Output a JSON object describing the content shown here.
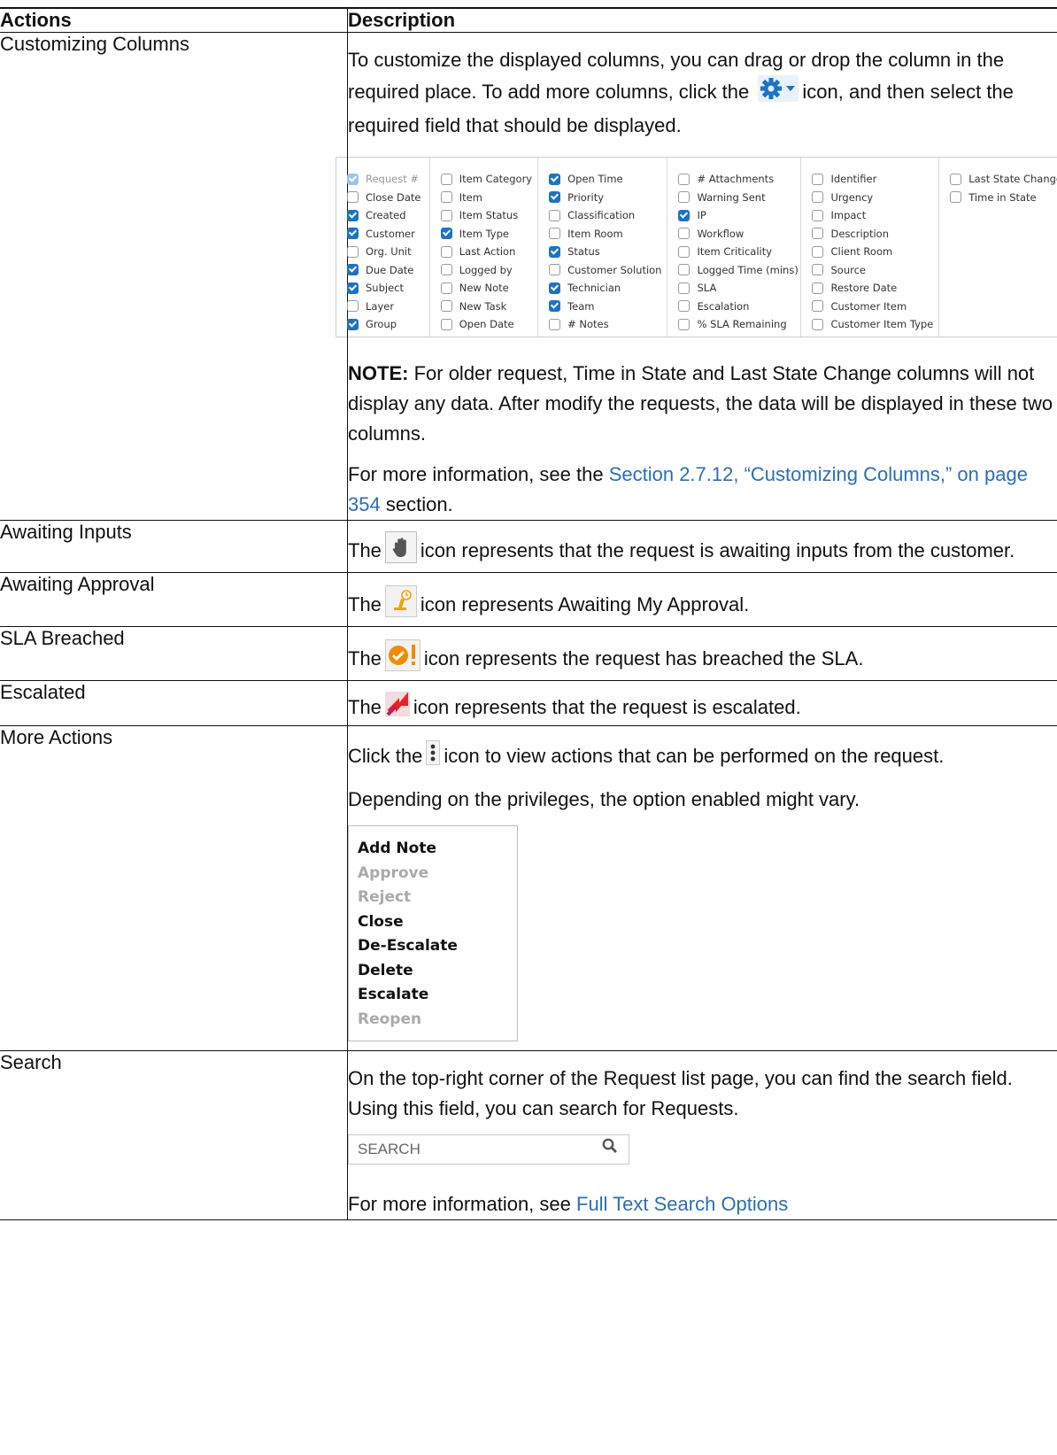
{
  "header": {
    "actions": "Actions",
    "description": "Description"
  },
  "rows": {
    "customizing": {
      "action": "Customizing Columns",
      "intro_1": "To customize the displayed columns, you can drag or drop the column in the required place. To add more columns, click the",
      "intro_2": "icon, and then select the required field that should be displayed.",
      "note_label": "NOTE:",
      "note_text": "For older request, Time in State and Last State Change columns will not display any data. After modify the requests, the data will be displayed in these two columns.",
      "more_pre": "For more information, see the",
      "more_link": "Section 2.7.12, “Customizing Columns,” on page 354",
      "more_post": "section."
    },
    "awaiting_inputs": {
      "action": "Awaiting Inputs",
      "pre": "The",
      "post": "icon represents that the request is awaiting inputs from the customer."
    },
    "awaiting_approval": {
      "action": "Awaiting Approval",
      "pre": "The",
      "post": "icon represents Awaiting My Approval."
    },
    "sla_breached": {
      "action": "SLA Breached",
      "pre": "The",
      "post": "icon represents the request has breached the SLA."
    },
    "escalated": {
      "action": "Escalated",
      "pre": "The",
      "post": "icon represents that the request is escalated."
    },
    "more_actions": {
      "action": "More Actions",
      "pre": "Click the",
      "post": "icon to view actions that can be performed on the request.",
      "line2": "Depending on the privileges, the option enabled might vary.",
      "menu": [
        "Add Note",
        "Approve",
        "Reject",
        "Close",
        "De-Escalate",
        "Delete",
        "Escalate",
        "Reopen"
      ]
    },
    "search": {
      "action": "Search",
      "text": "On the top-right corner of the Request list page, you can find the search field. Using this field, you can search for Requests.",
      "placeholder": "SEARCH",
      "more_pre": "For more information, see",
      "more_link": "Full Text Search Options"
    }
  },
  "columns_picker": [
    [
      "Request #",
      "Close Date",
      "Created",
      "Customer",
      "Org. Unit",
      "Due Date",
      "Subject",
      "Layer",
      "Group"
    ],
    [
      "Item Category",
      "Item",
      "Item Status",
      "Item Type",
      "Last Action",
      "Logged by",
      "New Note",
      "New Task",
      "Open Date"
    ],
    [
      "Open Time",
      "Priority",
      "Classification",
      "Item Room",
      "Status",
      "Customer Solution",
      "Technician",
      "Team",
      "# Notes"
    ],
    [
      "# Attachments",
      "Warning Sent",
      "IP",
      "Workflow",
      "Item Criticality",
      "Logged Time (mins)",
      "SLA",
      "Escalation",
      "% SLA Remaining"
    ],
    [
      "Identifier",
      "Urgency",
      "Impact",
      "Description",
      "Client Room",
      "Source",
      "Restore Date",
      "Customer Item",
      "Customer Item Type"
    ],
    [
      "Last State Change",
      "Time in State"
    ]
  ],
  "columns_checked": [
    "Created",
    "Customer",
    "Due Date",
    "Subject",
    "Group",
    "Item Type",
    "Open Time",
    "Priority",
    "Status",
    "Technician",
    "Team",
    "IP"
  ],
  "columns_disabled": [
    "Request #"
  ],
  "menu_disabled": [
    "Approve",
    "Reject",
    "Reopen"
  ],
  "colors": {
    "link": "#2a6fb7",
    "gear": "#1a73c8",
    "approval": "#f0a500",
    "sla": "#f08c00",
    "escalate": "#e8202a"
  }
}
